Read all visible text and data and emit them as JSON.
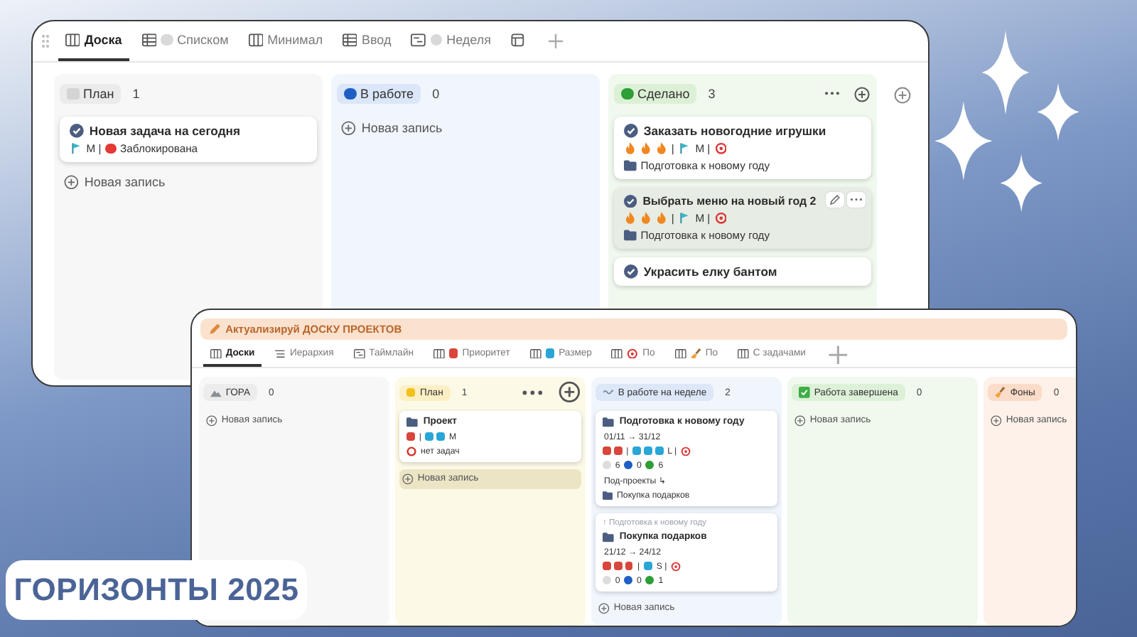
{
  "back_window": {
    "tabs": [
      {
        "label": "Доска",
        "kind": "board",
        "selected": true
      },
      {
        "label": "Списком",
        "kind": "table",
        "extra": {
          "kind": "dot",
          "color": "#d9d9d9"
        },
        "selected": false
      },
      {
        "label": "Минимал",
        "kind": "board",
        "selected": false
      },
      {
        "label": "Ввод",
        "kind": "table",
        "selected": false
      },
      {
        "label": "Неделя",
        "kind": "timeline",
        "extra": {
          "kind": "dot",
          "color": "#d9d9d9"
        },
        "selected": false
      },
      {
        "kind": "form",
        "selected": false
      }
    ],
    "columns": [
      {
        "label": "План",
        "count": "1",
        "color": "#ebebeb",
        "icon": {
          "kind": "square",
          "color": "#d4d4d4"
        },
        "menu": false,
        "cards": [
          {
            "kind": "check",
            "title": "Новая задача на сегодня",
            "hovered": false,
            "lines": [
              [
                {
                  "kind": "flag"
                },
                {
                  "kind": "text",
                  "text": "M |"
                },
                {
                  "kind": "dot",
                  "color": "#e53935"
                },
                {
                  "kind": "text",
                  "text": "Заблокирована"
                }
              ]
            ]
          }
        ],
        "new_record": {
          "label": "Новая запись",
          "hovered": false
        }
      },
      {
        "label": "В работе",
        "count": "0",
        "color": "#dbe7f8",
        "icon": {
          "kind": "dot",
          "color": "#1f5fc4"
        },
        "menu": false,
        "new_record": {
          "label": "Новая запись",
          "hovered": false
        }
      },
      {
        "label": "Сделано",
        "count": "3",
        "color": "#dcf0d5",
        "icon": {
          "kind": "dot",
          "color": "#2e9e36"
        },
        "menu": true,
        "cards": [
          {
            "kind": "check",
            "title": "Заказать новогодние игрушки",
            "hovered": false,
            "lines": [
              [
                {
                  "kind": "fire"
                },
                {
                  "kind": "fire"
                },
                {
                  "kind": "fire"
                },
                {
                  "kind": "text",
                  "text": "|"
                },
                {
                  "kind": "flag"
                },
                {
                  "kind": "text",
                  "text": "M |"
                },
                {
                  "kind": "target"
                }
              ],
              [
                {
                  "kind": "folder"
                },
                {
                  "kind": "text",
                  "text": "Подготовка к новому году"
                }
              ]
            ]
          },
          {
            "kind": "check",
            "title": "Выбрать меню на новый год 2",
            "hovered": true,
            "lines": [
              [
                {
                  "kind": "fire"
                },
                {
                  "kind": "fire"
                },
                {
                  "kind": "fire"
                },
                {
                  "kind": "text",
                  "text": "|"
                },
                {
                  "kind": "flag"
                },
                {
                  "kind": "text",
                  "text": "M |"
                },
                {
                  "kind": "target"
                }
              ],
              [
                {
                  "kind": "folder"
                },
                {
                  "kind": "text",
                  "text": "Подготовка к новому году"
                }
              ]
            ]
          },
          {
            "kind": "check",
            "title": "Украсить елку бантом",
            "hovered": false
          }
        ]
      }
    ]
  },
  "front_window": {
    "banner": "Актуализируй ДОСКУ ПРОЕКТОВ",
    "tabs": [
      {
        "label": "Доски",
        "kind": "board",
        "selected": true
      },
      {
        "label": "Иерархия",
        "kind": "list",
        "selected": false
      },
      {
        "label": "Таймлайн",
        "kind": "timeline",
        "selected": false
      },
      {
        "label": "Приоритет",
        "kind": "board",
        "extra": {
          "kind": "square",
          "color": "#d9453b"
        },
        "selected": false
      },
      {
        "label": "Размер",
        "kind": "board",
        "extra": {
          "kind": "square",
          "color": "#2aa6d6"
        },
        "selected": false
      },
      {
        "label": "По",
        "kind": "board",
        "extra": {
          "kind": "target"
        },
        "selected": false
      },
      {
        "label": "По",
        "kind": "board",
        "extra": {
          "kind": "brush"
        },
        "selected": false
      },
      {
        "label": "С задачами",
        "kind": "board",
        "selected": false
      }
    ],
    "columns": [
      {
        "label": "ГОРА",
        "count": "0",
        "color": "#ececec",
        "icon": {
          "kind": "mountain"
        },
        "menu": false,
        "new_record": {
          "label": "Новая запись",
          "hovered": false
        }
      },
      {
        "label": "План",
        "count": "1",
        "color": "#fbefc4",
        "icon": {
          "kind": "square",
          "color": "#f2c21b"
        },
        "menu": true,
        "cards": [
          {
            "kind": "folder",
            "title": "Проект",
            "hovered": false,
            "lines": [
              [
                {
                  "kind": "square",
                  "color": "#d9453b"
                },
                {
                  "kind": "text",
                  "text": "|"
                },
                {
                  "kind": "square",
                  "color": "#2aa6d6"
                },
                {
                  "kind": "square",
                  "color": "#2aa6d6"
                },
                {
                  "kind": "text",
                  "text": "M"
                }
              ],
              [
                {
                  "kind": "ring"
                },
                {
                  "kind": "text",
                  "text": "нет задач"
                }
              ]
            ]
          }
        ],
        "new_record": {
          "label": "Новая запись",
          "hovered": true
        }
      },
      {
        "label": "В работе на неделе",
        "count": "2",
        "color": "#dde7f8",
        "icon": {
          "kind": "wave"
        },
        "menu": false,
        "cards": [
          {
            "kind": "folder",
            "title": "Подготовка к новому году",
            "hovered": false,
            "lines": [
              [
                {
                  "kind": "text",
                  "text": "01/11 → 31/12"
                }
              ],
              [
                {
                  "kind": "square",
                  "color": "#d9453b"
                },
                {
                  "kind": "square",
                  "color": "#d9453b"
                },
                {
                  "kind": "text",
                  "text": "|"
                },
                {
                  "kind": "square",
                  "color": "#2aa6d6"
                },
                {
                  "kind": "square",
                  "color": "#2aa6d6"
                },
                {
                  "kind": "square",
                  "color": "#2aa6d6"
                },
                {
                  "kind": "text",
                  "text": "L |"
                },
                {
                  "kind": "target"
                }
              ],
              [
                {
                  "kind": "dot",
                  "color": "#dddddd"
                },
                {
                  "kind": "text",
                  "text": "6"
                },
                {
                  "kind": "dot",
                  "color": "#1f5fc4"
                },
                {
                  "kind": "text",
                  "text": "0"
                },
                {
                  "kind": "dot",
                  "color": "#2e9e36"
                },
                {
                  "kind": "text",
                  "text": "6"
                }
              ],
              [
                {
                  "kind": "text",
                  "text": "Под-проекты ↳"
                }
              ],
              [
                {
                  "kind": "folder"
                },
                {
                  "kind": "text",
                  "text": "Покупка подарков"
                }
              ]
            ]
          },
          {
            "parent": "↑ Подготовка к новому году",
            "kind": "folder",
            "title": "Покупка подарков",
            "hovered": false,
            "lines": [
              [
                {
                  "kind": "text",
                  "text": "21/12 → 24/12"
                }
              ],
              [
                {
                  "kind": "square",
                  "color": "#d9453b"
                },
                {
                  "kind": "square",
                  "color": "#d9453b"
                },
                {
                  "kind": "square",
                  "color": "#d9453b"
                },
                {
                  "kind": "text",
                  "text": "|"
                },
                {
                  "kind": "square",
                  "color": "#2aa6d6"
                },
                {
                  "kind": "text",
                  "text": "S |"
                },
                {
                  "kind": "target"
                }
              ],
              [
                {
                  "kind": "dot",
                  "color": "#dddddd"
                },
                {
                  "kind": "text",
                  "text": "0"
                },
                {
                  "kind": "dot",
                  "color": "#1f5fc4"
                },
                {
                  "kind": "text",
                  "text": "0"
                },
                {
                  "kind": "dot",
                  "color": "#2e9e36"
                },
                {
                  "kind": "text",
                  "text": "1"
                }
              ]
            ]
          }
        ],
        "new_record": {
          "label": "Новая запись",
          "hovered": false
        }
      },
      {
        "label": "Работа завершена",
        "count": "0",
        "color": "#ddf0d8",
        "icon": {
          "kind": "checkbox"
        },
        "menu": false,
        "new_record": {
          "label": "Новая запись",
          "hovered": false
        }
      },
      {
        "label": "Фоны",
        "count": "0",
        "color": "#fbdcc8",
        "icon": {
          "kind": "brush"
        },
        "new_record": {
          "label": "Новая запись",
          "hovered": false
        }
      }
    ]
  },
  "caption": "ГОРИЗОНТЫ 2025"
}
